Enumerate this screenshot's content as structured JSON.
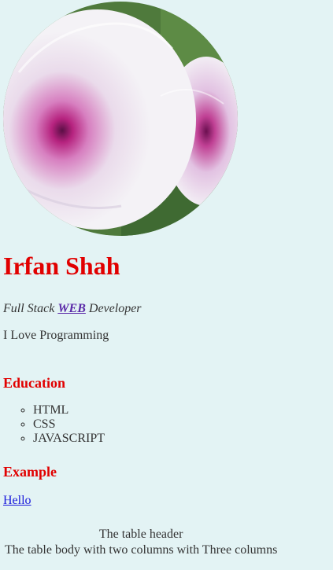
{
  "profile": {
    "name": "Irfan Shah",
    "role_prefix": "Full Stack",
    "role_link": "WEB",
    "role_suffix": "Developer",
    "tagline": "I Love Programming"
  },
  "education": {
    "heading": "Education",
    "items": [
      "HTML",
      "CSS",
      "JAVASCRIPT"
    ]
  },
  "example": {
    "heading": "Example",
    "link": "Hello",
    "table": {
      "header": "The table header",
      "body": "The table body with two columns with Three columns"
    }
  },
  "colors": {
    "heading": "#e10000",
    "background": "#e3f3f4",
    "link": "#1a1adb"
  }
}
